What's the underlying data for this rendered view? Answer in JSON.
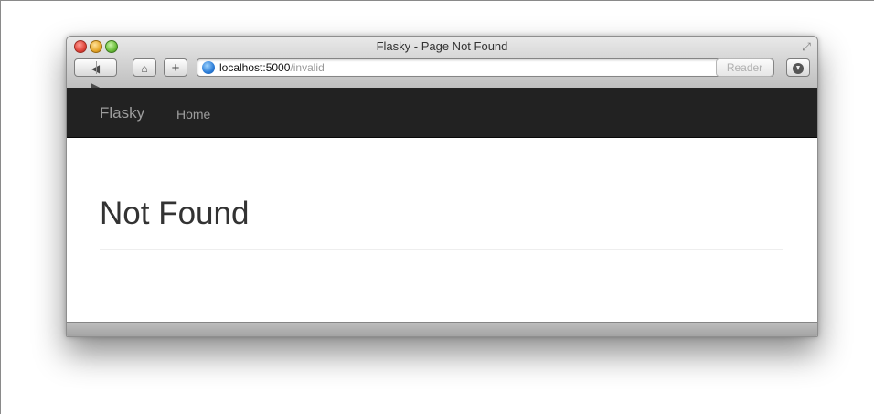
{
  "window": {
    "title": "Flasky - Page Not Found"
  },
  "toolbar": {
    "back_label": "◀",
    "forward_label": "▶",
    "home_label": "⌂",
    "new_tab_label": "+",
    "reload_label": "↻",
    "reader_label": "Reader"
  },
  "address_bar": {
    "host": "localhost:5000",
    "path": "/invalid"
  },
  "navbar": {
    "brand": "Flasky",
    "items": [
      {
        "label": "Home"
      }
    ]
  },
  "page": {
    "heading": "Not Found"
  },
  "icons": {
    "close": "close-icon",
    "minimize": "minimize-icon",
    "zoom": "zoom-icon",
    "fullscreen": "fullscreen-icon",
    "globe": "globe-icon",
    "download": "download-icon"
  },
  "colors": {
    "navbar_bg": "#222222",
    "navbar_text": "#9d9d9d",
    "heading_text": "#333333"
  }
}
